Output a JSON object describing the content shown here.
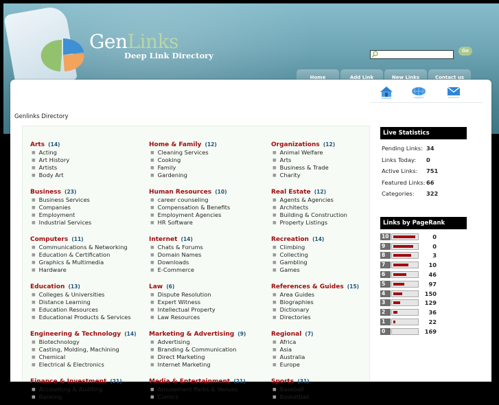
{
  "header": {
    "logo_gen": "Gen",
    "logo_links": "Links",
    "tagline": "Deep Link Directory",
    "search_placeholder": "",
    "search_value": "",
    "go_label": "Go",
    "nav": [
      {
        "label": "Home"
      },
      {
        "label": "Add Link"
      },
      {
        "label": "New Links"
      },
      {
        "label": "Contact us"
      }
    ],
    "icons": [
      "home-icon",
      "globe-icon",
      "mail-icon"
    ]
  },
  "breadcrumb": "Genlinks Directory",
  "colors": {
    "category": "#a00d12",
    "count": "#21527a",
    "accent_bar": "#a00d12"
  },
  "directory": {
    "columns": [
      [
        {
          "title": "Arts",
          "count": "(14)",
          "subs": [
            "Acting",
            "Art History",
            "Artists",
            "Body Art"
          ]
        },
        {
          "title": "Business",
          "count": "(23)",
          "subs": [
            "Business Services",
            "Companies",
            "Employment",
            "Industrial Services"
          ]
        },
        {
          "title": "Computers",
          "count": "(11)",
          "subs": [
            "Communications & Networking",
            "Education & Certification",
            "Graphics & Multimedia",
            "Hardware"
          ]
        },
        {
          "title": "Education",
          "count": "(13)",
          "subs": [
            "Colleges & Universities",
            "Distance Learning",
            "Education Resources",
            "Educational Products & Services"
          ]
        },
        {
          "title": "Engineering & Technology",
          "count": "(14)",
          "subs": [
            "Biotechnology",
            "Casting, Molding, Machining",
            "Chemical",
            "Electrical & Electronics"
          ]
        },
        {
          "title": "Finance & Investment",
          "count": "(21)",
          "subs": [
            "Accounting & Auditing",
            "Banking"
          ]
        }
      ],
      [
        {
          "title": "Home & Family",
          "count": "(12)",
          "subs": [
            "Cleaning Services",
            "Cooking",
            "Family",
            "Gardening"
          ]
        },
        {
          "title": "Human Resources",
          "count": "(10)",
          "subs": [
            "career counseling",
            "Compensation & Benefits",
            "Employment Agencies",
            "HR Software"
          ]
        },
        {
          "title": "Internet",
          "count": "(14)",
          "subs": [
            "Chats & Forums",
            "Domain Names",
            "Downloads",
            "E-Commerce"
          ]
        },
        {
          "title": "Law",
          "count": "(6)",
          "subs": [
            "Dispute Resolution",
            "Expert Witness",
            "Intellectual Property",
            "Law Resources"
          ]
        },
        {
          "title": "Marketing & Advertising",
          "count": "(9)",
          "subs": [
            "Advertising",
            "Branding & Communication",
            "Direct Marketing",
            "Internet Marketing"
          ]
        },
        {
          "title": "Media & Entertainment",
          "count": "(21)",
          "subs": [
            "Amusement Parks & Venues",
            "Comics"
          ]
        }
      ],
      [
        {
          "title": "Organizations",
          "count": "(12)",
          "subs": [
            "Animal Welfare",
            "Arts",
            "Business & Trade",
            "Charity"
          ]
        },
        {
          "title": "Real Estate",
          "count": "(12)",
          "subs": [
            "Agents & Agencies",
            "Architects",
            "Building & Construction",
            "Property Listings"
          ]
        },
        {
          "title": "Recreation",
          "count": "(14)",
          "subs": [
            "Climbing",
            "Collecting",
            "Gambling",
            "Games"
          ]
        },
        {
          "title": "References & Guides",
          "count": "(15)",
          "subs": [
            "Area Guides",
            "Biographies",
            "Dictionary",
            "Directories"
          ]
        },
        {
          "title": "Regional",
          "count": "(7)",
          "subs": [
            "Africa",
            "Asia",
            "Australia",
            "Europe"
          ]
        },
        {
          "title": "Sports",
          "count": "(31)",
          "subs": [
            "Baseball",
            "Basketball"
          ]
        }
      ]
    ]
  },
  "live_stats": {
    "title": "Live Statistics",
    "rows": [
      {
        "label": "Pending Links:",
        "value": "34"
      },
      {
        "label": "Links Today:",
        "value": "0"
      },
      {
        "label": "Active Links:",
        "value": "751"
      },
      {
        "label": "Featured Links:",
        "value": "66"
      },
      {
        "label": "Categories:",
        "value": "322"
      }
    ]
  },
  "pagerank": {
    "title": "Links by PageRank",
    "rows": [
      {
        "rank": "10",
        "count": "0",
        "fill": 1.0
      },
      {
        "rank": "9",
        "count": "0",
        "fill": 0.9
      },
      {
        "rank": "8",
        "count": "3",
        "fill": 0.8
      },
      {
        "rank": "7",
        "count": "10",
        "fill": 0.7
      },
      {
        "rank": "6",
        "count": "46",
        "fill": 0.6
      },
      {
        "rank": "5",
        "count": "97",
        "fill": 0.5
      },
      {
        "rank": "4",
        "count": "150",
        "fill": 0.4
      },
      {
        "rank": "3",
        "count": "129",
        "fill": 0.3
      },
      {
        "rank": "2",
        "count": "36",
        "fill": 0.2
      },
      {
        "rank": "1",
        "count": "22",
        "fill": 0.1
      },
      {
        "rank": "0",
        "count": "169",
        "fill": 0.0
      }
    ]
  }
}
